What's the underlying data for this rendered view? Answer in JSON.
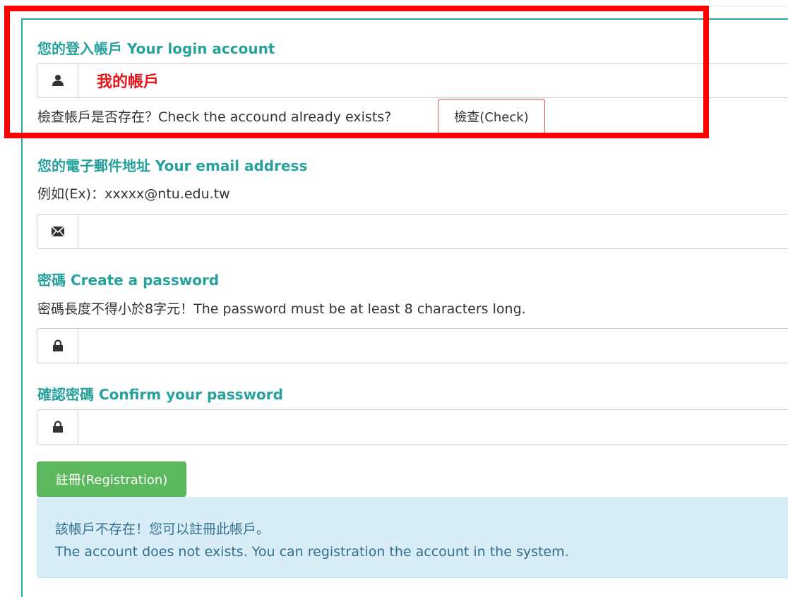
{
  "colors": {
    "accent": "#26a19b",
    "highlight": "#ff0000",
    "account_text": "#e8151b",
    "success": "#5cb85c",
    "danger_border": "#d9534f",
    "info_bg": "#d9edf7"
  },
  "account": {
    "heading": "您的登入帳戶 Your login account",
    "icon": "user-icon",
    "value": "我的帳戶",
    "check_prompt": "檢查帳戶是否存在？Check the accound already exists?",
    "check_button": "檢查(Check)"
  },
  "email": {
    "heading": "您的電子郵件地址 Your email address",
    "example": "例如(Ex)：xxxxx@ntu.edu.tw",
    "icon": "envelope-icon",
    "value": ""
  },
  "password": {
    "heading": "密碼 Create a password",
    "hint": "密碼長度不得小於8字元！The password must be at least 8 characters long.",
    "icon": "lock-icon",
    "value": ""
  },
  "confirm_password": {
    "heading": "確認密碼 Confirm your password",
    "icon": "lock-icon",
    "value": ""
  },
  "register_button": "註冊(Registration)",
  "alert": {
    "line1": "該帳戶不存在！您可以註冊此帳戶。",
    "line2": "The account does not exists. You can registration the account in the system."
  }
}
